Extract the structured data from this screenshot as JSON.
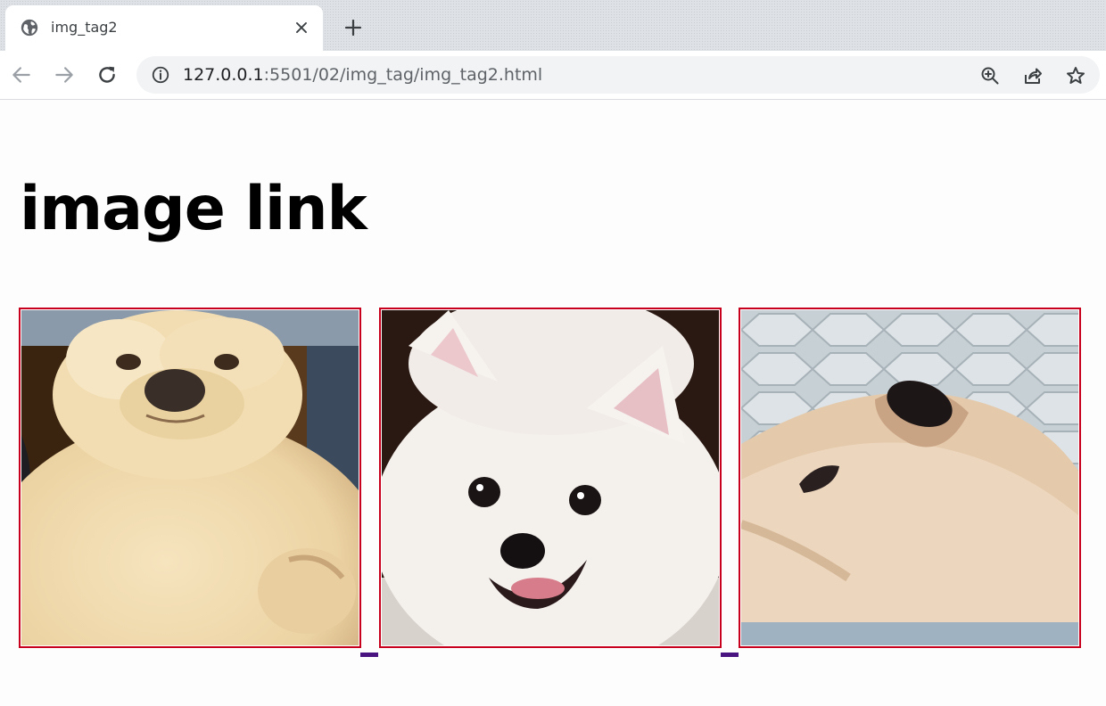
{
  "browser": {
    "tab": {
      "title": "img_tag2"
    },
    "address": {
      "host": "127.0.0.1",
      "rest": ":5501/02/img_tag/img_tag2.html"
    }
  },
  "page": {
    "heading": "image link",
    "images": [
      {
        "subject": "pomeranian puppy close-up"
      },
      {
        "subject": "smiling white pomeranian"
      },
      {
        "subject": "pomeranian lying on quilt"
      }
    ]
  },
  "colors": {
    "link_border": "#c8001e",
    "visited_underline": "#4a1480"
  }
}
